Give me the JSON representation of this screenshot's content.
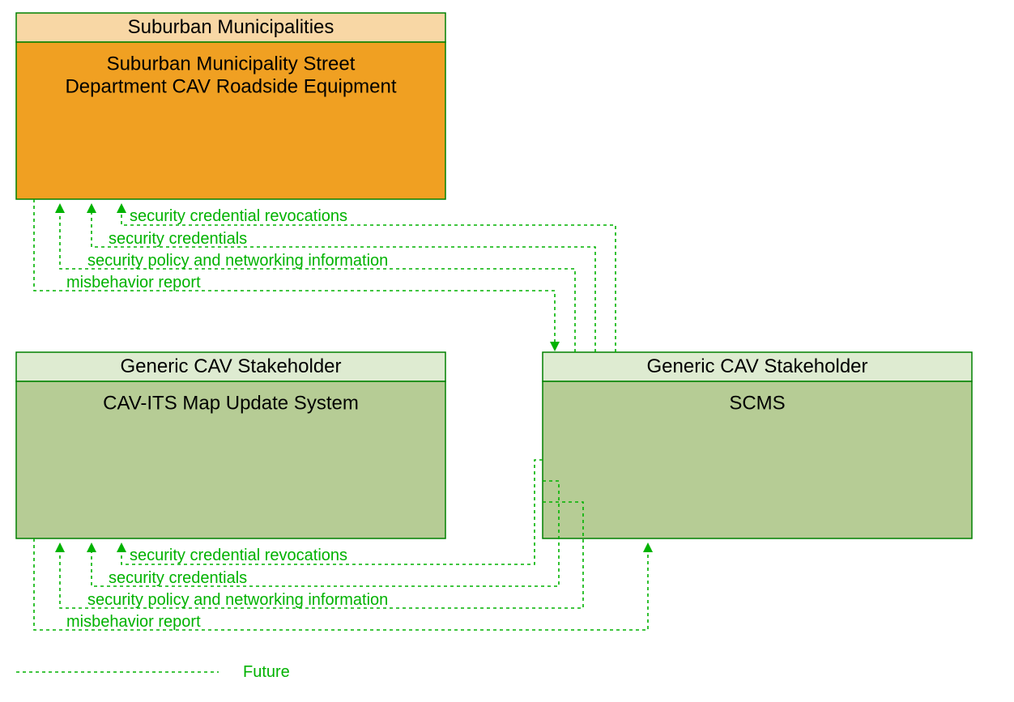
{
  "boxes": {
    "box1": {
      "header": "Suburban Municipalities",
      "body_line1": "Suburban Municipality Street",
      "body_line2": "Department CAV Roadside Equipment"
    },
    "box2": {
      "header": "Generic CAV Stakeholder",
      "body": "CAV-ITS Map Update System"
    },
    "box3": {
      "header": "Generic CAV Stakeholder",
      "body": "SCMS"
    }
  },
  "flows_upper": {
    "f1": "security credential revocations",
    "f2": "security credentials",
    "f3": "security policy and networking information",
    "f4": "misbehavior report"
  },
  "flows_lower": {
    "f1": "security credential revocations",
    "f2": "security credentials",
    "f3": "security policy and networking information",
    "f4": "misbehavior report"
  },
  "legend": {
    "future": "Future"
  },
  "colors": {
    "orange_header": "#F8D7A5",
    "orange_body": "#F0A022",
    "green_header": "#DEEBD1",
    "green_body": "#B6CC95",
    "border": "#008000",
    "flow": "#00B200"
  }
}
